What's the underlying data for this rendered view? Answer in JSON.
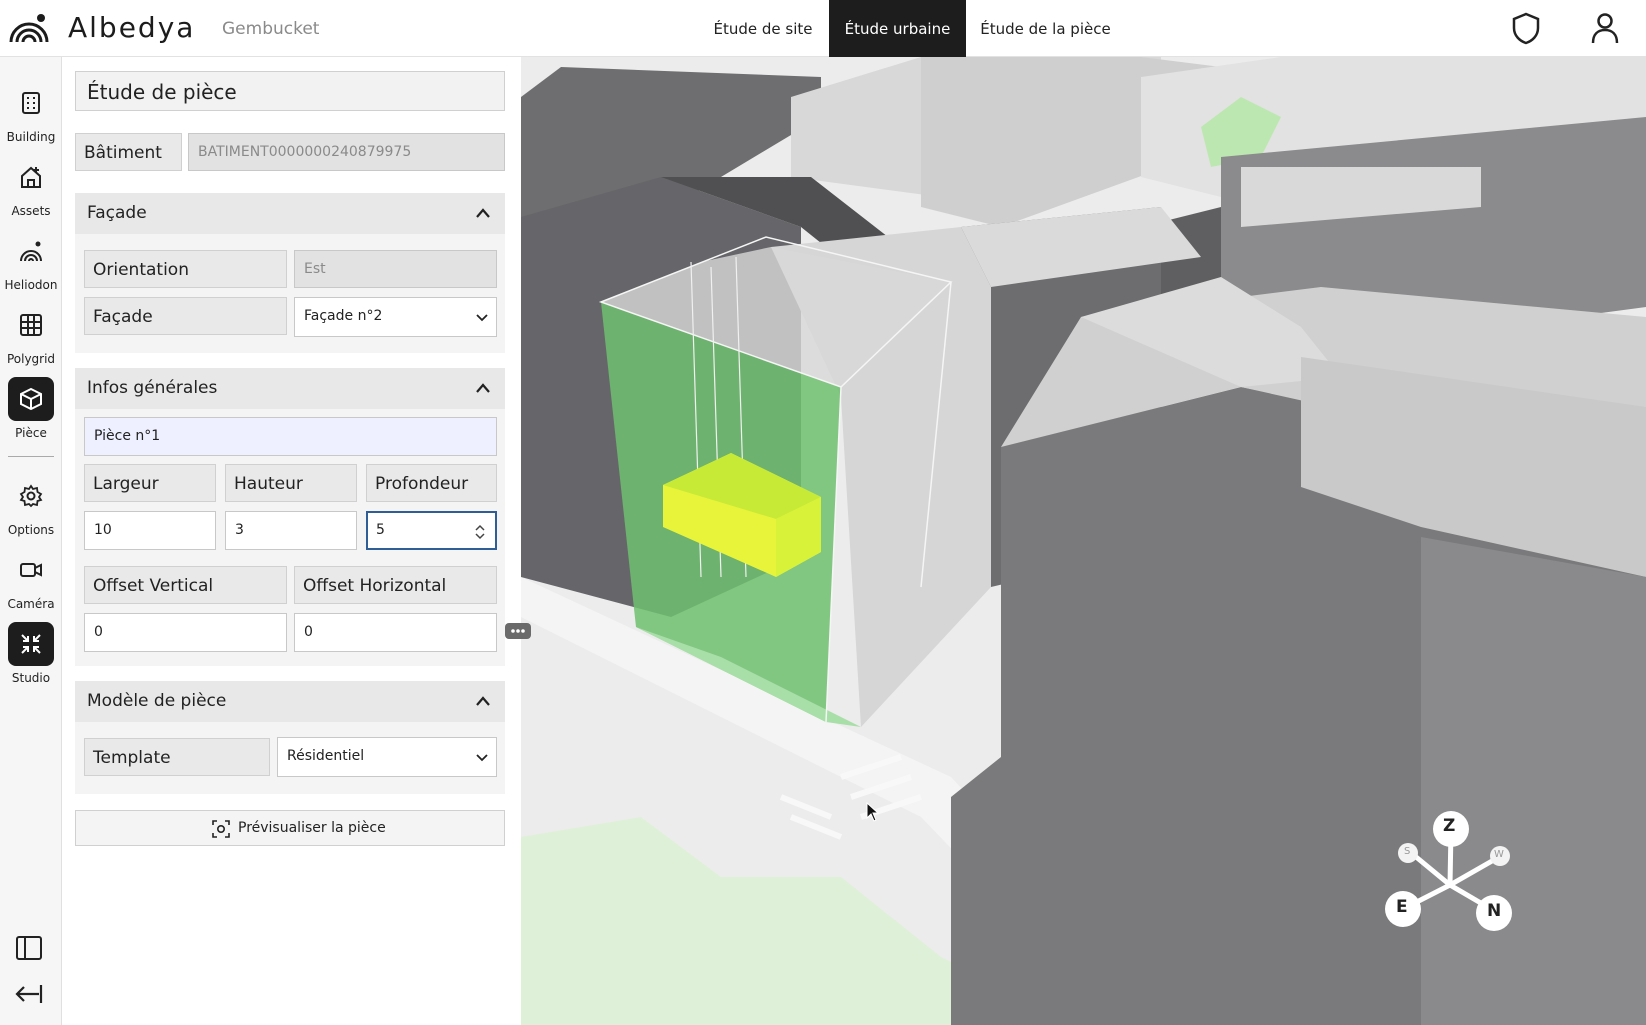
{
  "app": {
    "brand": "Albedya",
    "project": "Gembucket"
  },
  "nav": {
    "tabs": [
      {
        "label": "Étude de site"
      },
      {
        "label": "Étude urbaine"
      },
      {
        "label": "Étude de la pièce"
      }
    ],
    "active_tab": "Étude urbaine"
  },
  "sidebar": {
    "items": [
      {
        "label": "Building",
        "icon": "building-icon"
      },
      {
        "label": "Assets",
        "icon": "house-plus-icon"
      },
      {
        "label": "Heliodon",
        "icon": "heliodon-icon"
      },
      {
        "label": "Polygrid",
        "icon": "grid-icon"
      },
      {
        "label": "Pièce",
        "icon": "cube-icon"
      },
      {
        "label": "Options",
        "icon": "gear-icon"
      },
      {
        "label": "Caméra",
        "icon": "video-camera-icon"
      },
      {
        "label": "Studio",
        "icon": "collapse-arrows-icon"
      }
    ],
    "active_item": "Pièce"
  },
  "panel": {
    "title": "Étude de pièce",
    "building": {
      "label": "Bâtiment",
      "value": "BATIMENT0000000240879975"
    },
    "facade_section": {
      "title": "Façade",
      "orientation_label": "Orientation",
      "orientation_value": "Est",
      "facade_label": "Façade",
      "facade_value": "Façade n°2"
    },
    "general_section": {
      "title": "Infos générales",
      "name_value": "Pièce n°1",
      "width_label": "Largeur",
      "height_label": "Hauteur",
      "depth_label": "Profondeur",
      "width_value": "10",
      "height_value": "3",
      "depth_value": "5",
      "offset_v_label": "Offset Vertical",
      "offset_h_label": "Offset Horizontal",
      "offset_v_value": "0",
      "offset_h_value": "0"
    },
    "model_section": {
      "title": "Modèle de pièce",
      "template_label": "Template",
      "template_value": "Résidentiel"
    },
    "preview_button": "Prévisualiser la pièce"
  },
  "compass": {
    "labels": [
      "Z",
      "E",
      "N",
      "S",
      "W"
    ]
  },
  "colors": {
    "active_dark": "#1d1d1d",
    "room_fill": "#d8f23a",
    "facade_green": "#7fcf7f",
    "focus_border": "#2f5e97"
  }
}
